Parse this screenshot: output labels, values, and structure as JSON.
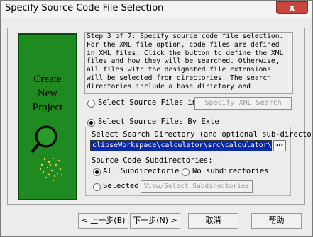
{
  "window": {
    "title": "Specify Source Code File Selection",
    "close_label": "x"
  },
  "side_panel": {
    "text": "Create\nNew\nProject"
  },
  "description": "Step 3 of 7: Specify source code file selection.\nFor the XML file option, code files are defined\nin XML files. Click the button to define the XML\nfiles and how they will be searched. Otherwise,\nall files with the designated file extensions\nwill be selected from directories. The search\ndirectories include a base dirictory and",
  "options": {
    "xml_label": "Select Source Files in",
    "xml_button": "Specify XML Search",
    "ext_label": "Select Source Files By Exte",
    "search_dir_label": "Select Search Directory (and optional sub-director",
    "path_value": "clipseWorkspace\\calculator\\src\\calculator\\",
    "browse_label": "…",
    "subdir_label": "Source Code Subdirectories:",
    "all_subdirs": "All Subdirectorie",
    "no_subdirs": "No subdirectories",
    "selected": "Selected",
    "view_select_button": "View/Select Subdirectories"
  },
  "buttons": {
    "back": "< 上一步(B)",
    "next": "下一步(N) >",
    "cancel": "取消",
    "help": "帮助"
  }
}
